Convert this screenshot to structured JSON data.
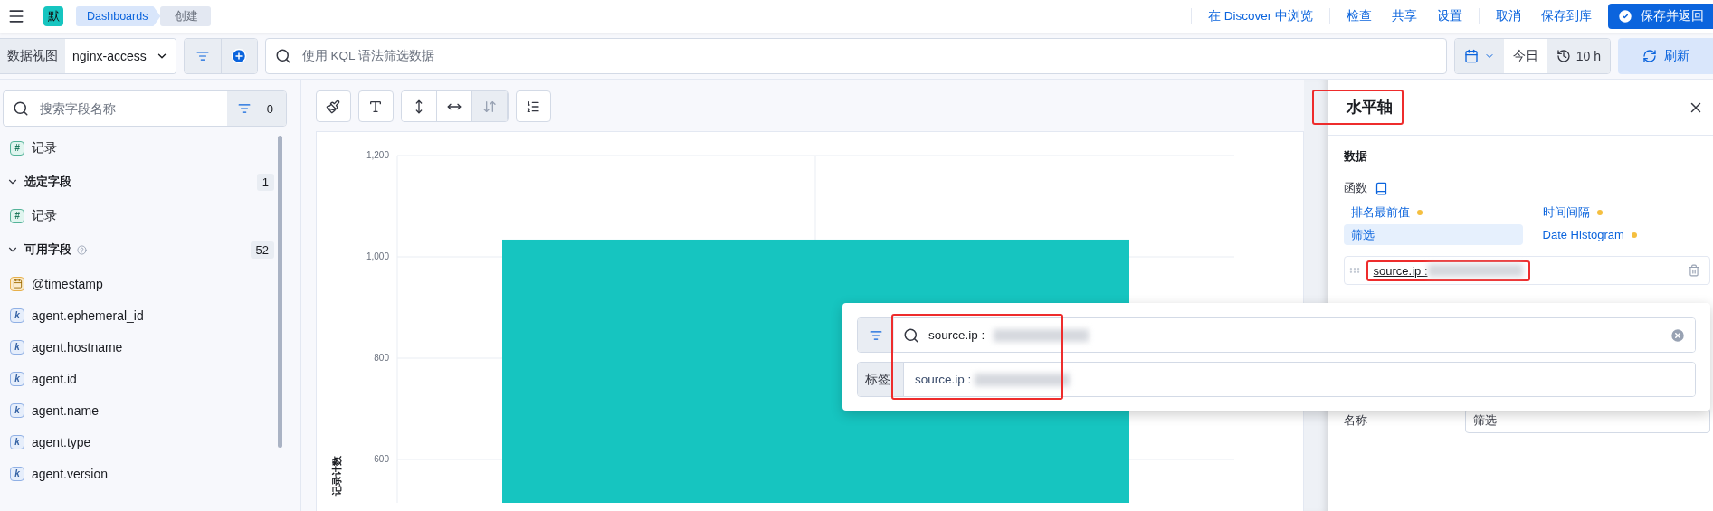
{
  "top_bar": {
    "logo": "默",
    "breadcrumbs": [
      {
        "label": "Dashboards",
        "selected": false
      },
      {
        "label": "创建",
        "selected": true
      }
    ],
    "link_groups": [
      [
        "在 Discover 中浏览"
      ],
      [
        "检查",
        "共享",
        "设置"
      ],
      [
        "取消",
        "保存到库"
      ]
    ],
    "primary_button": "保存并返回"
  },
  "query_bar": {
    "data_view_label": "数据视图",
    "data_view": "nginx-access",
    "query_placeholder": "使用 KQL 语法筛选数据",
    "date_label": "今日",
    "refresh_interval": "10 h",
    "refresh_button": "刷新"
  },
  "sidebar": {
    "search_placeholder": "搜索字段名称",
    "filter_count": "0",
    "pinned_fields": [
      {
        "kind": "number",
        "glyph": "#",
        "name": "记录"
      }
    ],
    "sections": [
      {
        "title": "选定字段",
        "count": "1",
        "expanded": true,
        "help": false,
        "fields": [
          {
            "kind": "number",
            "glyph": "#",
            "name": "记录"
          }
        ]
      },
      {
        "title": "可用字段",
        "count": "52",
        "expanded": true,
        "help": true,
        "fields": [
          {
            "kind": "date",
            "name": "@timestamp"
          },
          {
            "kind": "keyword",
            "glyph": "k",
            "name": "agent.ephemeral_id"
          },
          {
            "kind": "keyword",
            "glyph": "k",
            "name": "agent.hostname"
          },
          {
            "kind": "keyword",
            "glyph": "k",
            "name": "agent.id"
          },
          {
            "kind": "keyword",
            "glyph": "k",
            "name": "agent.name"
          },
          {
            "kind": "keyword",
            "glyph": "k",
            "name": "agent.type"
          },
          {
            "kind": "keyword",
            "glyph": "k",
            "name": "agent.version"
          }
        ]
      }
    ]
  },
  "chart_toolbar": {
    "axis_buttons": [
      {
        "selected": false
      },
      {
        "selected": false
      },
      {
        "selected": true
      }
    ]
  },
  "chart": {
    "chart_data": {
      "type": "bar",
      "ylabel": "记录计数",
      "ylim": [
        514,
        1200
      ],
      "grid": true,
      "values": [
        1034
      ],
      "yticks": [
        {
          "value": 600,
          "label": "600"
        },
        {
          "value": 800,
          "label": "800"
        },
        {
          "value": 1000,
          "label": "1,000"
        },
        {
          "value": 1200,
          "label": "1,200"
        }
      ]
    }
  },
  "panel": {
    "title": "水平轴",
    "title_highlighted": true,
    "section": "数据",
    "functions_label": "函数",
    "functions": [
      {
        "label": "排名最前值",
        "selected": false,
        "dot": true
      },
      {
        "label": "时间间隔",
        "selected": false,
        "dot": true
      },
      {
        "label": "筛选",
        "selected": true,
        "dot": false
      },
      {
        "label": "Date Histogram",
        "selected": false,
        "dot": true
      }
    ],
    "filters": [
      {
        "label": "source.ip :",
        "redacted": true,
        "highlighted": true
      }
    ],
    "name_label": "名称",
    "name_value": "筛选"
  },
  "popup": {
    "query": "source.ip :",
    "redacted": true,
    "highlighted": true,
    "prefix_label": "标签",
    "suggestions": [
      {
        "label": "source.ip :",
        "redacted": true
      }
    ]
  }
}
